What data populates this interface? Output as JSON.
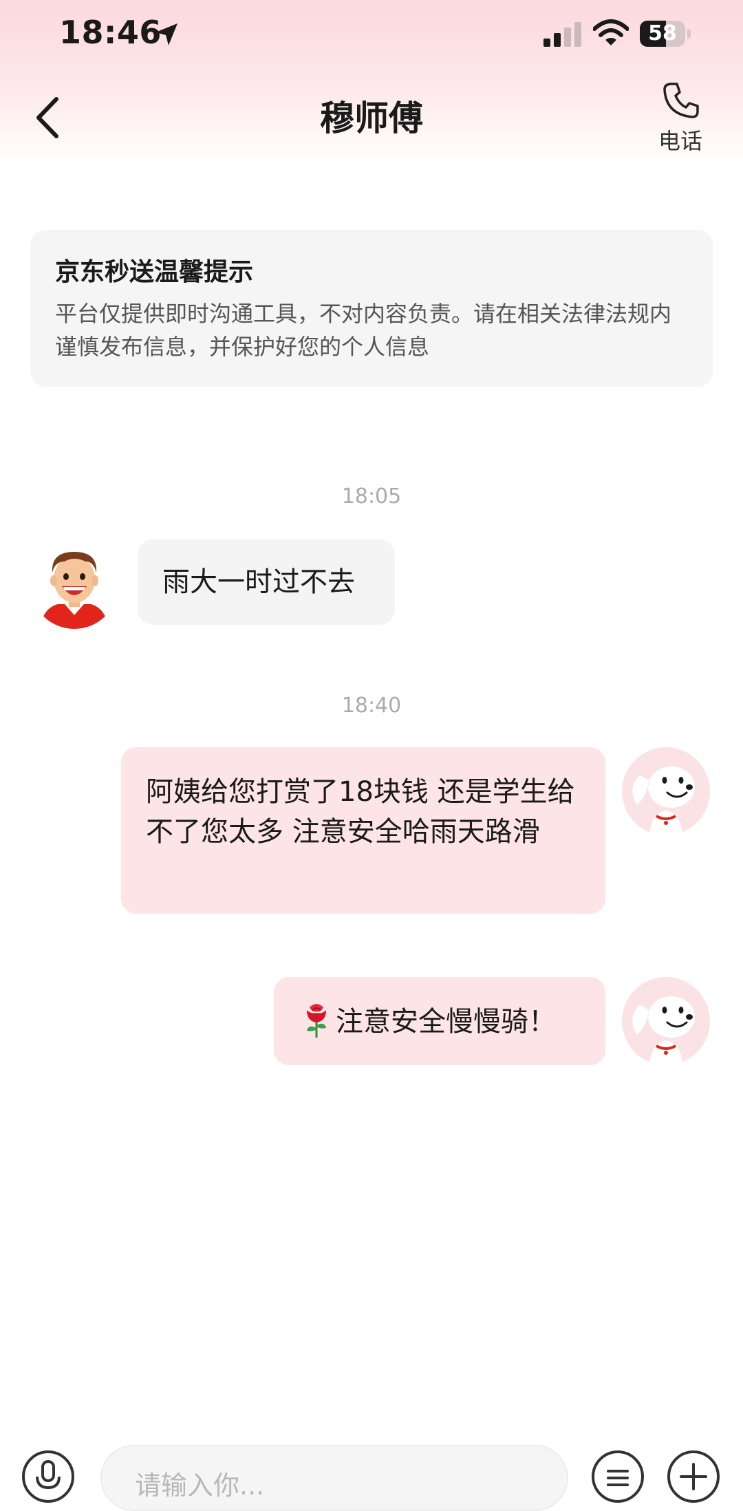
{
  "status_bar": {
    "time": "18:46",
    "battery_level": "58",
    "battery_percent": 58
  },
  "nav": {
    "title": "穆师傅",
    "call_label": "电话"
  },
  "notice": {
    "title": "京东秒送温馨提示",
    "body": "平台仅提供即时沟通工具，不对内容负责。请在相关法律法规内谨慎发布信息，并保护好您的个人信息"
  },
  "messages": [
    {
      "timestamp": "18:05",
      "direction": "incoming",
      "text": "雨大一时过不去"
    },
    {
      "timestamp": "18:40",
      "direction": "outgoing",
      "text": "阿姨给您打赏了18块钱 还是学生给不了您太多 注意安全哈雨天路滑"
    },
    {
      "direction": "outgoing",
      "emoji": "rose-icon",
      "text": "注意安全慢慢骑！"
    }
  ],
  "input": {
    "placeholder": "请输入你..."
  },
  "colors": {
    "header_gradient_top": "#fbd9dd",
    "outgoing_bubble": "#fde4e6",
    "incoming_bubble": "#f4f4f5",
    "accent_red": "#e1251b"
  }
}
